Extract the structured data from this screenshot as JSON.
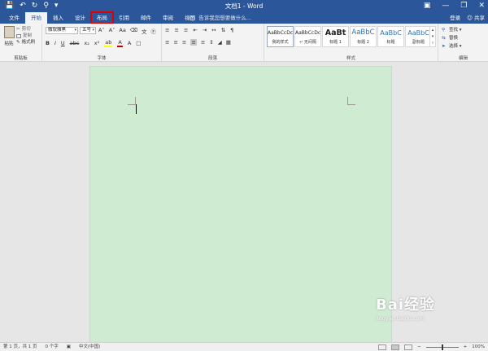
{
  "window": {
    "title": "文档1 - Word",
    "qat": [
      "save-icon",
      "undo-icon",
      "redo-icon",
      "share-network-icon",
      "customize-icon"
    ],
    "controls": [
      "restore-icon",
      "minimize-icon",
      "maximize-icon",
      "close-icon"
    ]
  },
  "tabs": [
    {
      "label": "文件"
    },
    {
      "label": "开始",
      "active": true
    },
    {
      "label": "插入"
    },
    {
      "label": "设计"
    },
    {
      "label": "布局",
      "highlighted": true
    },
    {
      "label": "引用"
    },
    {
      "label": "邮件"
    },
    {
      "label": "审阅"
    },
    {
      "label": "视图"
    }
  ],
  "tellme": {
    "text": "告诉我您想要做什么..."
  },
  "account": {
    "login": "登录",
    "share": "共享"
  },
  "clipboard": {
    "paste": "粘贴",
    "cut": "剪切",
    "copy": "复制",
    "format_painter": "格式刷",
    "label": "剪贴板"
  },
  "font": {
    "name": "微软雅黑",
    "size": "五号",
    "label": "字体"
  },
  "paragraph": {
    "label": "段落"
  },
  "styles": {
    "items": [
      {
        "preview": "AaBbCcDc",
        "name": "我的样式"
      },
      {
        "preview": "AaBbCcDc",
        "name": "↵ 无间隔"
      },
      {
        "preview": "AaBt",
        "name": "标题 1"
      },
      {
        "preview": "AaBbC",
        "name": "标题 2"
      },
      {
        "preview": "AaBbC",
        "name": "标题"
      },
      {
        "preview": "AaBbC",
        "name": "副标题"
      }
    ],
    "label": "样式"
  },
  "editing": {
    "find": "查找",
    "replace": "替换",
    "select": "选择",
    "label": "编辑"
  },
  "status": {
    "page": "第 1 页，共 1 页",
    "words": "0 个字",
    "language": "中文(中国)",
    "zoom": "100%"
  },
  "watermark": {
    "brand": "Bai经验",
    "url": "jingyan.baidu.com"
  },
  "colors": {
    "ribbon_blue": "#2b579a",
    "page_bg": "#cfebd2",
    "highlight_box": "#e00000"
  }
}
